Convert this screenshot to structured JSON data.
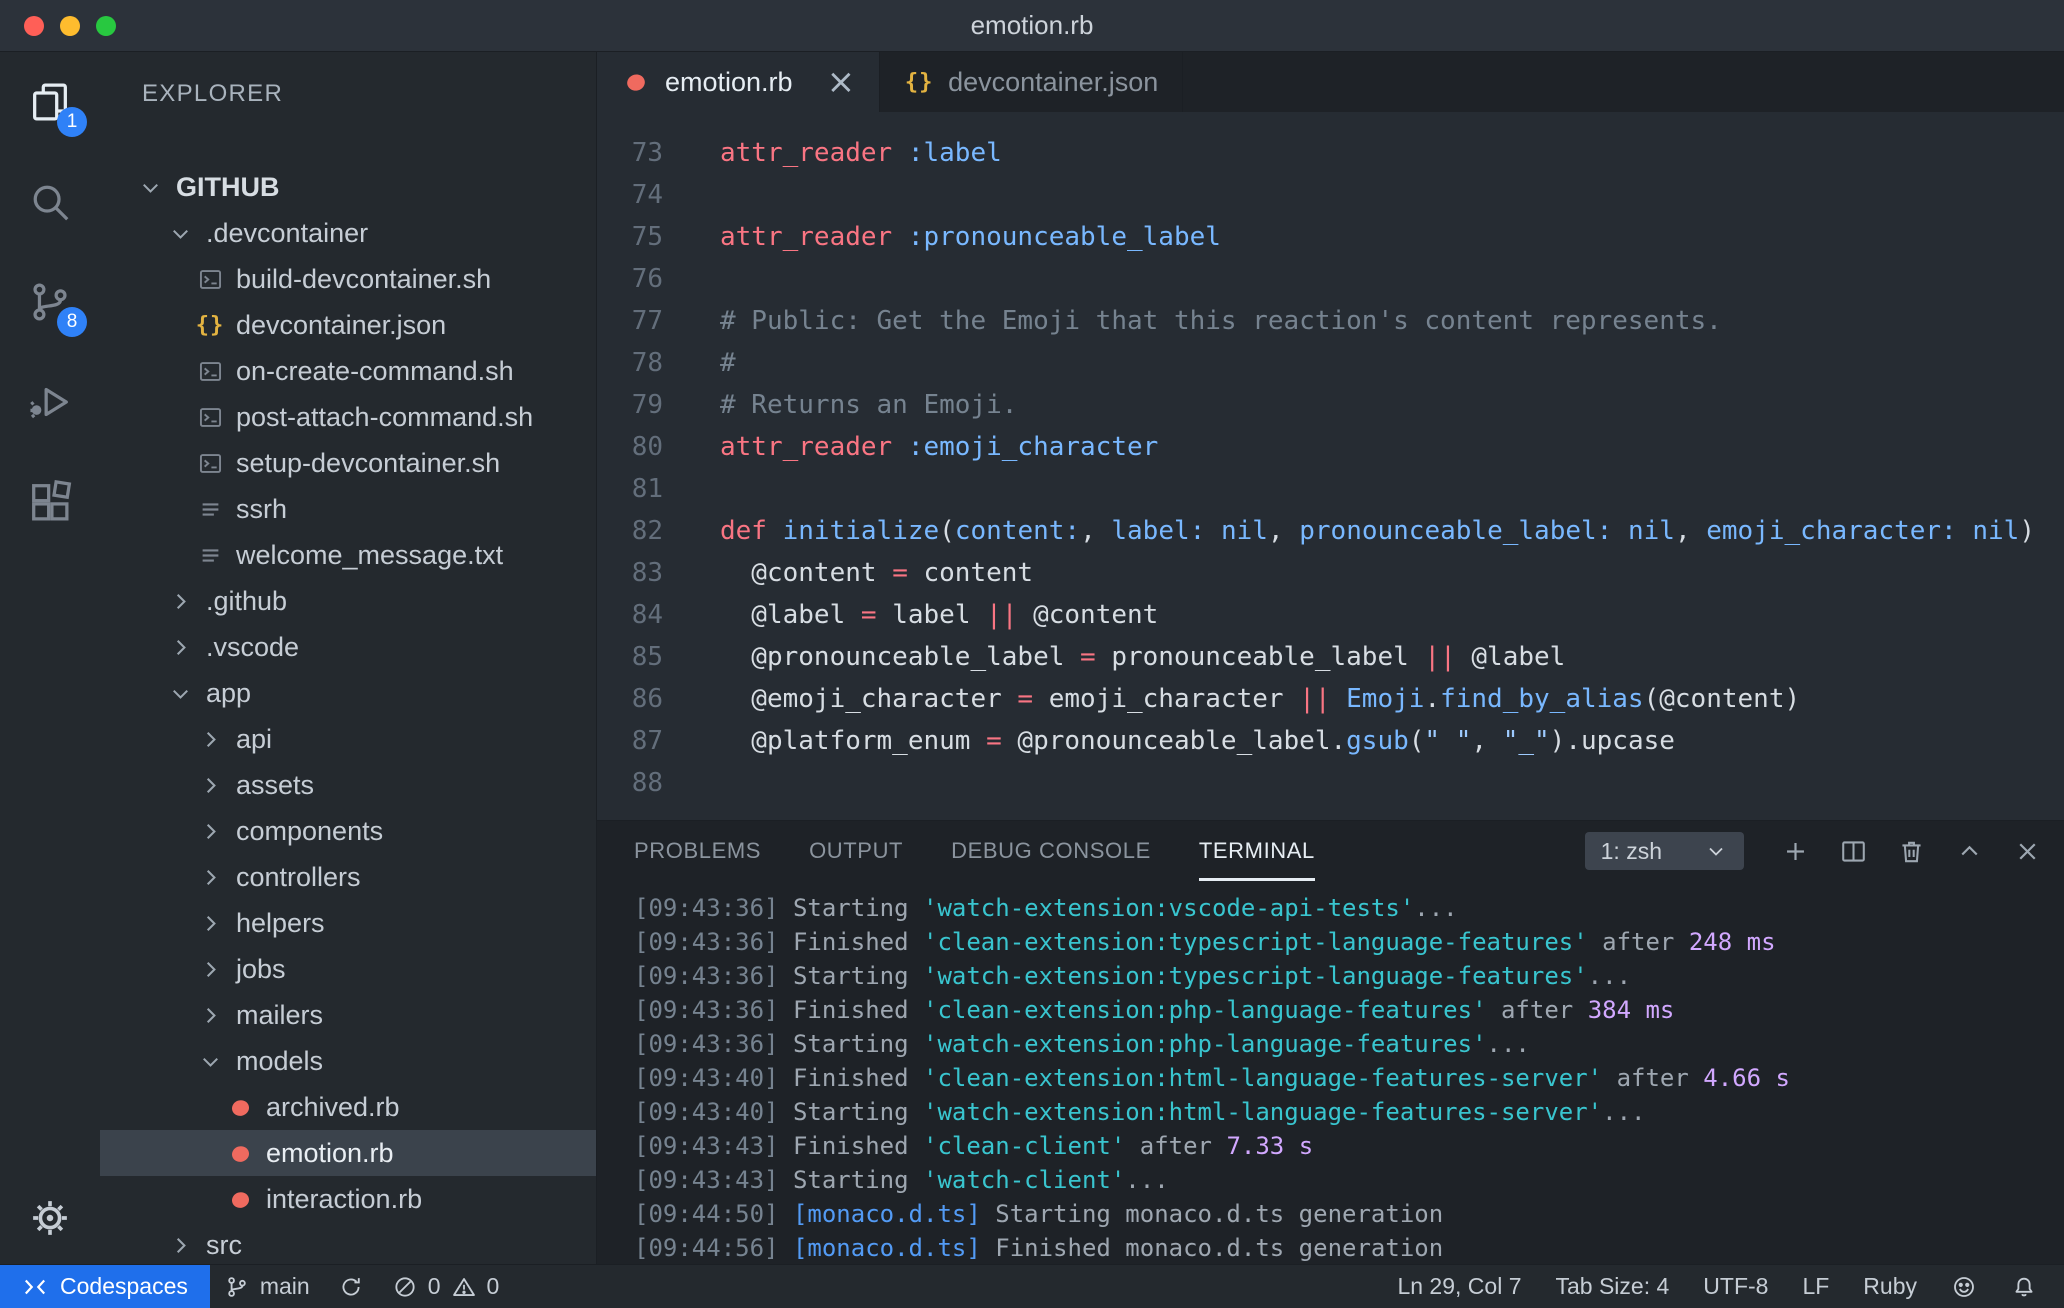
{
  "colors": {
    "titlebar_bg": "#2c323a",
    "chrome_bg": "#24292e",
    "editor_bg": "#262c33",
    "panel_bg": "#1e2227",
    "selection_bg": "#3b434c",
    "select_bg": "#3d444e",
    "border_dark": "#1b1f24",
    "accent_blue": "#2f81f7",
    "codespaces_blue": "#1f6feb",
    "linenum": "#636e7b",
    "syntax_keyword": "#f97583",
    "syntax_constant": "#79b8ff",
    "syntax_string": "#9ecbff",
    "syntax_comment": "#768390",
    "term_ts": "#768390",
    "term_text": "#9ea7b1",
    "term_cyan": "#39c5cf",
    "term_magenta": "#d2a8ff",
    "term_blue": "#539bf5",
    "ruby_icon": "#ef6a5f",
    "json_icon": "#e3b341",
    "traffic_red": "#ff5f57",
    "traffic_yellow": "#febc2e",
    "traffic_green": "#28c840"
  },
  "titlebar": {
    "title": "emotion.rb"
  },
  "activity_bar": {
    "explorer_badge": "1",
    "source_control_badge": "8"
  },
  "sidebar": {
    "header": "EXPLORER",
    "items": [
      {
        "label": "GITHUB",
        "level": 0,
        "icon": "chevron-down",
        "root": true
      },
      {
        "label": ".devcontainer",
        "level": 1,
        "icon": "chevron-down"
      },
      {
        "label": "build-devcontainer.sh",
        "level": 2,
        "icon": "shell"
      },
      {
        "label": "devcontainer.json",
        "level": 2,
        "icon": "json"
      },
      {
        "label": "on-create-command.sh",
        "level": 2,
        "icon": "shell"
      },
      {
        "label": "post-attach-command.sh",
        "level": 2,
        "icon": "shell"
      },
      {
        "label": "setup-devcontainer.sh",
        "level": 2,
        "icon": "shell"
      },
      {
        "label": "ssrh",
        "level": 2,
        "icon": "list"
      },
      {
        "label": "welcome_message.txt",
        "level": 2,
        "icon": "list"
      },
      {
        "label": ".github",
        "level": 1,
        "icon": "chevron-right"
      },
      {
        "label": ".vscode",
        "level": 1,
        "icon": "chevron-right"
      },
      {
        "label": "app",
        "level": 1,
        "icon": "chevron-down"
      },
      {
        "label": "api",
        "level": 2,
        "icon": "chevron-right"
      },
      {
        "label": "assets",
        "level": 2,
        "icon": "chevron-right"
      },
      {
        "label": "components",
        "level": 2,
        "icon": "chevron-right"
      },
      {
        "label": "controllers",
        "level": 2,
        "icon": "chevron-right"
      },
      {
        "label": "helpers",
        "level": 2,
        "icon": "chevron-right"
      },
      {
        "label": "jobs",
        "level": 2,
        "icon": "chevron-right"
      },
      {
        "label": "mailers",
        "level": 2,
        "icon": "chevron-right"
      },
      {
        "label": "models",
        "level": 2,
        "icon": "chevron-down"
      },
      {
        "label": "archived.rb",
        "level": 3,
        "icon": "ruby"
      },
      {
        "label": "emotion.rb",
        "level": 3,
        "icon": "ruby",
        "selected": true
      },
      {
        "label": "interaction.rb",
        "level": 3,
        "icon": "ruby"
      },
      {
        "label": "src",
        "level": 1,
        "icon": "chevron-right"
      }
    ]
  },
  "tabs": [
    {
      "label": "emotion.rb",
      "icon": "ruby",
      "active": true,
      "close_glyph": "×"
    },
    {
      "label": "devcontainer.json",
      "icon": "json",
      "active": false
    }
  ],
  "editor": {
    "lines": [
      {
        "n": "73",
        "t": [
          [
            "k",
            "attr_reader"
          ],
          [
            "t",
            " "
          ],
          [
            "s",
            ":label"
          ]
        ]
      },
      {
        "n": "74",
        "t": []
      },
      {
        "n": "75",
        "t": [
          [
            "k",
            "attr_reader"
          ],
          [
            "t",
            " "
          ],
          [
            "s",
            ":pronounceable_label"
          ]
        ]
      },
      {
        "n": "76",
        "t": []
      },
      {
        "n": "77",
        "t": [
          [
            "c",
            "# Public: Get the Emoji that this reaction's content represents."
          ]
        ]
      },
      {
        "n": "78",
        "t": [
          [
            "c",
            "#"
          ]
        ]
      },
      {
        "n": "79",
        "t": [
          [
            "c",
            "# Returns an Emoji."
          ]
        ]
      },
      {
        "n": "80",
        "t": [
          [
            "k",
            "attr_reader"
          ],
          [
            "t",
            " "
          ],
          [
            "s",
            ":emoji_character"
          ]
        ]
      },
      {
        "n": "81",
        "t": []
      },
      {
        "n": "82",
        "t": [
          [
            "k",
            "def"
          ],
          [
            "t",
            " "
          ],
          [
            "f",
            "initialize"
          ],
          [
            "t",
            "("
          ],
          [
            "s",
            "content:"
          ],
          [
            "t",
            ", "
          ],
          [
            "s",
            "label:"
          ],
          [
            "t",
            " "
          ],
          [
            "s",
            "nil"
          ],
          [
            "t",
            ", "
          ],
          [
            "s",
            "pronounceable_label:"
          ],
          [
            "t",
            " "
          ],
          [
            "s",
            "nil"
          ],
          [
            "t",
            ", "
          ],
          [
            "s",
            "emoji_character:"
          ],
          [
            "t",
            " "
          ],
          [
            "s",
            "nil"
          ],
          [
            "t",
            ")"
          ]
        ]
      },
      {
        "n": "83",
        "t": [
          [
            "t",
            "  @content "
          ],
          [
            "k",
            "="
          ],
          [
            "t",
            " content"
          ]
        ]
      },
      {
        "n": "84",
        "t": [
          [
            "t",
            "  @label "
          ],
          [
            "k",
            "="
          ],
          [
            "t",
            " label "
          ],
          [
            "k",
            "||"
          ],
          [
            "t",
            " @content"
          ]
        ]
      },
      {
        "n": "85",
        "t": [
          [
            "t",
            "  @pronounceable_label "
          ],
          [
            "k",
            "="
          ],
          [
            "t",
            " pronounceable_label "
          ],
          [
            "k",
            "||"
          ],
          [
            "t",
            " @label"
          ]
        ]
      },
      {
        "n": "86",
        "t": [
          [
            "t",
            "  @emoji_character "
          ],
          [
            "k",
            "="
          ],
          [
            "t",
            " emoji_character "
          ],
          [
            "k",
            "||"
          ],
          [
            "t",
            " "
          ],
          [
            "s",
            "Emoji"
          ],
          [
            "t",
            "."
          ],
          [
            "f",
            "find_by_alias"
          ],
          [
            "t",
            "(@content)"
          ]
        ]
      },
      {
        "n": "87",
        "t": [
          [
            "t",
            "  @platform_enum "
          ],
          [
            "k",
            "="
          ],
          [
            "t",
            " @pronounceable_label."
          ],
          [
            "f",
            "gsub"
          ],
          [
            "t",
            "("
          ],
          [
            "q",
            "\" \""
          ],
          [
            "t",
            ", "
          ],
          [
            "q",
            "\"_\""
          ],
          [
            "t",
            ").upcase"
          ]
        ]
      },
      {
        "n": "88",
        "t": []
      }
    ]
  },
  "panel": {
    "tabs": [
      "PROBLEMS",
      "OUTPUT",
      "DEBUG CONSOLE",
      "TERMINAL"
    ],
    "active_tab": "TERMINAL",
    "shell_label": "1: zsh",
    "terminal_lines": [
      [
        [
          "ts",
          "[09:43:36]"
        ],
        [
          "t",
          " Starting "
        ],
        [
          "c",
          "'watch-extension:vscode-api-tests'"
        ],
        [
          "t",
          "..."
        ]
      ],
      [
        [
          "ts",
          "[09:43:36]"
        ],
        [
          "t",
          " Finished "
        ],
        [
          "c",
          "'clean-extension:typescript-language-features'"
        ],
        [
          "t",
          " after "
        ],
        [
          "m",
          "248 ms"
        ]
      ],
      [
        [
          "ts",
          "[09:43:36]"
        ],
        [
          "t",
          " Starting "
        ],
        [
          "c",
          "'watch-extension:typescript-language-features'"
        ],
        [
          "t",
          "..."
        ]
      ],
      [
        [
          "ts",
          "[09:43:36]"
        ],
        [
          "t",
          " Finished "
        ],
        [
          "c",
          "'clean-extension:php-language-features'"
        ],
        [
          "t",
          " after "
        ],
        [
          "m",
          "384 ms"
        ]
      ],
      [
        [
          "ts",
          "[09:43:36]"
        ],
        [
          "t",
          " Starting "
        ],
        [
          "c",
          "'watch-extension:php-language-features'"
        ],
        [
          "t",
          "..."
        ]
      ],
      [
        [
          "ts",
          "[09:43:40]"
        ],
        [
          "t",
          " Finished "
        ],
        [
          "c",
          "'clean-extension:html-language-features-server'"
        ],
        [
          "t",
          " after "
        ],
        [
          "m",
          "4.66 s"
        ]
      ],
      [
        [
          "ts",
          "[09:43:40]"
        ],
        [
          "t",
          " Starting "
        ],
        [
          "c",
          "'watch-extension:html-language-features-server'"
        ],
        [
          "t",
          "..."
        ]
      ],
      [
        [
          "ts",
          "[09:43:43]"
        ],
        [
          "t",
          " Finished "
        ],
        [
          "c",
          "'clean-client'"
        ],
        [
          "t",
          " after "
        ],
        [
          "m",
          "7.33 s"
        ]
      ],
      [
        [
          "ts",
          "[09:43:43]"
        ],
        [
          "t",
          " Starting "
        ],
        [
          "c",
          "'watch-client'"
        ],
        [
          "t",
          "..."
        ]
      ],
      [
        [
          "ts",
          "[09:44:50]"
        ],
        [
          "b",
          " [monaco.d.ts]"
        ],
        [
          "t",
          " Starting monaco.d.ts generation"
        ]
      ],
      [
        [
          "ts",
          "[09:44:56]"
        ],
        [
          "b",
          " [monaco.d.ts]"
        ],
        [
          "t",
          " Finished monaco.d.ts generation"
        ]
      ]
    ]
  },
  "statusbar": {
    "codespaces_label": "Codespaces",
    "branch": "main",
    "errors": "0",
    "warnings": "0",
    "cursor_position": "Ln 29, Col 7",
    "tab_size": "Tab Size: 4",
    "encoding": "UTF-8",
    "eol": "LF",
    "language": "Ruby"
  }
}
